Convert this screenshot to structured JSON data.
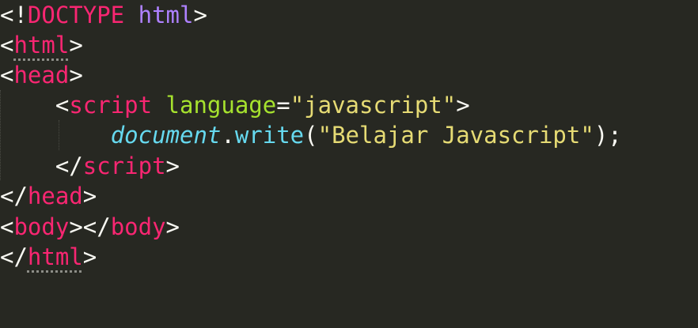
{
  "code": {
    "doctype_open": "<!",
    "doctype_kw": "DOCTYPE",
    "doctype_space": " ",
    "doctype_html": "html",
    "doctype_close": ">",
    "lt": "<",
    "gt": ">",
    "lt_slash": "</",
    "html_tag": "html",
    "head_tag": "head",
    "body_tag": "body",
    "script_tag": "script",
    "indent1": "    ",
    "indent2": "        ",
    "space": " ",
    "attr_name": "language",
    "equals": "=",
    "attr_value": "\"javascript\"",
    "object": "document",
    "dot": ".",
    "method": "write",
    "open_paren": "(",
    "string_arg": "\"Belajar Javascript\"",
    "close_paren_semi": ");"
  },
  "colors": {
    "background": "#272822",
    "tag": "#f92672",
    "attribute": "#a6e22e",
    "string": "#e6db74",
    "builtin": "#66d9ef",
    "doctype_keyword": "#ae81ff",
    "punctuation": "#f8f8f2"
  }
}
